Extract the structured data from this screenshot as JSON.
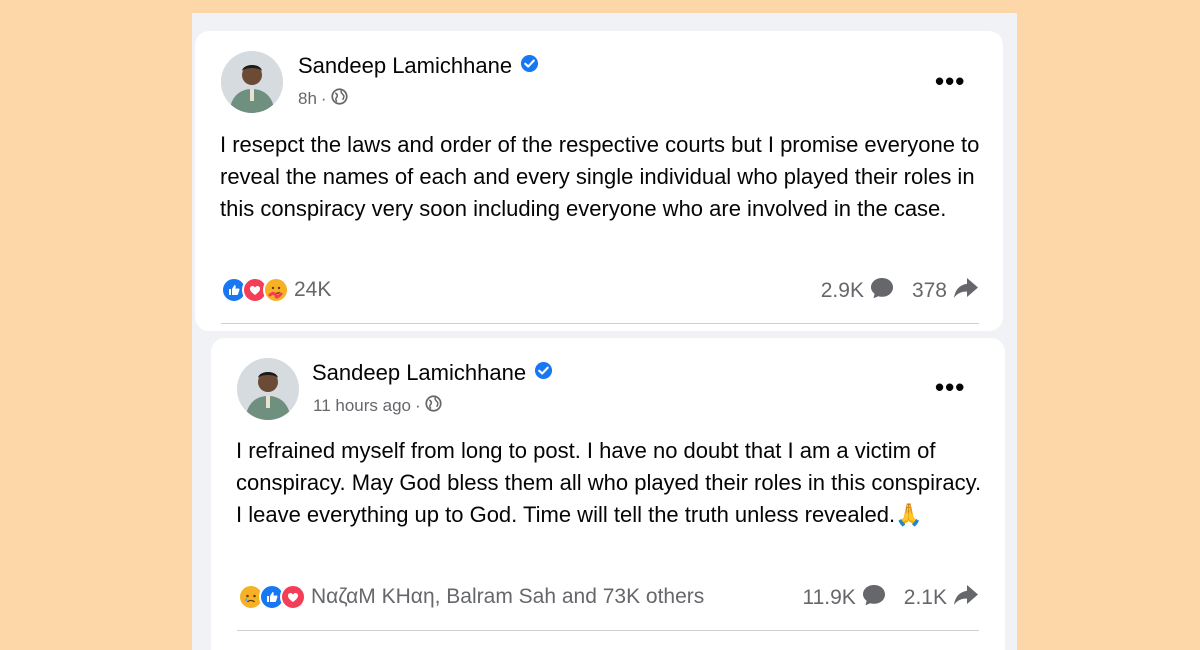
{
  "posts": [
    {
      "author": "Sandeep Lamichhane",
      "time": "8h",
      "text": "I resepct the laws and order of the respective courts but I promise everyone to reveal the names of each and every single individual who played their roles in this conspiracy very soon including everyone who are involved in the case.",
      "reactions_label": "24K",
      "comments": "2.9K",
      "shares": "378",
      "reaction_icons": [
        "like-icon",
        "love-icon",
        "care-icon"
      ]
    },
    {
      "author": "Sandeep Lamichhane",
      "time": "11 hours ago",
      "text": "I refrained myself from long to post. I have no doubt that I am a victim of conspiracy. May God bless them all who played their roles in this conspiracy. I leave everything up to God. Time will tell the truth unless revealed.🙏",
      "reactions_label": "ΝαζαΜ ΚΗαη, Balram Sah and 73K others",
      "comments": "11.9K",
      "shares": "2.1K",
      "reaction_icons": [
        "sad-icon",
        "like-icon",
        "love-icon"
      ]
    }
  ],
  "colors": {
    "page_background": "#fed7a9",
    "feed_background": "#f0f2f5",
    "card": "#ffffff",
    "verified": "#1877f2",
    "like": "#1877f2",
    "love": "#f33e58",
    "care_sad": "#f7b125",
    "secondary_text": "#65676b"
  }
}
